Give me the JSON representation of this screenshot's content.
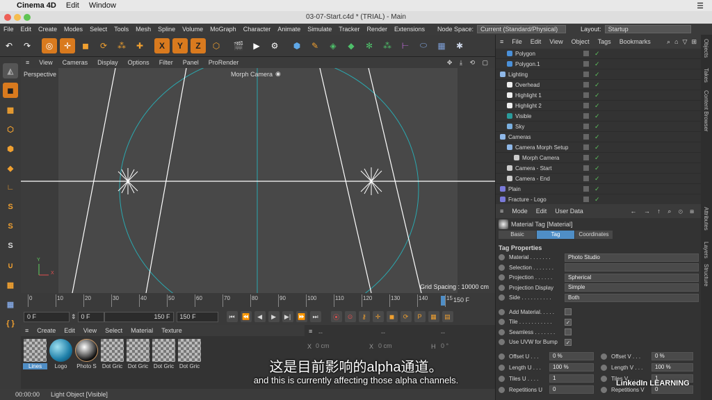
{
  "mac_menu": {
    "app": "Cinema 4D",
    "items": [
      "Edit",
      "Window"
    ]
  },
  "window_title": "03-07-Start.c4d * (TRIAL) - Main",
  "main_menu": [
    "File",
    "Edit",
    "Create",
    "Modes",
    "Select",
    "Tools",
    "Mesh",
    "Spline",
    "Volume",
    "MoGraph",
    "Character",
    "Animate",
    "Simulate",
    "Tracker",
    "Render",
    "Extensions"
  ],
  "node_space": {
    "label": "Node Space:",
    "value": "Current (Standard/Physical)"
  },
  "layout": {
    "label": "Layout:",
    "value": "Startup"
  },
  "viewport": {
    "menu": [
      "View",
      "Cameras",
      "Display",
      "Options",
      "Filter",
      "Panel",
      "ProRender"
    ],
    "name": "Perspective",
    "camera": "Morph Camera",
    "grid_spacing": "Grid Spacing : 10000 cm",
    "axis_y": "Y",
    "axis_x": "X"
  },
  "timeline": {
    "ticks": [
      "0",
      "10",
      "20",
      "30",
      "40",
      "50",
      "60",
      "70",
      "80",
      "90",
      "100",
      "110",
      "120",
      "130",
      "140",
      "15"
    ],
    "end_label": "150 F"
  },
  "transport": {
    "current": "0 F",
    "start": "0 F",
    "end": "150 F",
    "max": "150 F"
  },
  "material_manager": {
    "menu": [
      "Create",
      "Edit",
      "View",
      "Select",
      "Material",
      "Texture"
    ],
    "materials": [
      "Lines",
      "Logo",
      "Photo S",
      "Dot Gric",
      "Dot Gric",
      "Dot Gric",
      "Dot Gric"
    ]
  },
  "coords": {
    "dash": "--",
    "x_label": "X",
    "x_value": "0 cm",
    "x2_label": "X",
    "x2_value": "0 cm",
    "h_label": "H",
    "h_value": "0 °"
  },
  "status": {
    "time": "00:00:00",
    "text": "Light Object [Visible]"
  },
  "object_manager": {
    "menu": [
      "File",
      "Edit",
      "View",
      "Object",
      "Tags",
      "Bookmarks"
    ],
    "objects": [
      {
        "name": "Polygon",
        "indent": 1,
        "icon": "#4a90d9"
      },
      {
        "name": "Polygon.1",
        "indent": 1,
        "icon": "#4a90d9"
      },
      {
        "name": "Lighting",
        "indent": 0,
        "icon": "#8fb8e8"
      },
      {
        "name": "Overhead",
        "indent": 1,
        "icon": "#eeeeee"
      },
      {
        "name": "Highlight 1",
        "indent": 1,
        "icon": "#eeeeee"
      },
      {
        "name": "Highlight 2",
        "indent": 1,
        "icon": "#eeeeee"
      },
      {
        "name": "Visible",
        "indent": 1,
        "icon": "#2a9c9c"
      },
      {
        "name": "Sky",
        "indent": 1,
        "icon": "#7ab0e0"
      },
      {
        "name": "Cameras",
        "indent": 0,
        "icon": "#8fb8e8"
      },
      {
        "name": "Camera Morph Setup",
        "indent": 1,
        "icon": "#8fb8e8"
      },
      {
        "name": "Morph Camera",
        "indent": 2,
        "icon": "#cccccc"
      },
      {
        "name": "Camera - Start",
        "indent": 1,
        "icon": "#cccccc"
      },
      {
        "name": "Camera - End",
        "indent": 1,
        "icon": "#cccccc"
      },
      {
        "name": "Plain",
        "indent": 0,
        "icon": "#7a7ad9"
      },
      {
        "name": "Fracture - Logo",
        "indent": 0,
        "icon": "#7a7ad9"
      }
    ]
  },
  "attributes": {
    "menu": [
      "Mode",
      "Edit",
      "User Data"
    ],
    "title": "Material Tag [Material]",
    "tabs": [
      "Basic",
      "Tag",
      "Coordinates"
    ],
    "section": "Tag Properties",
    "props": [
      {
        "label": "Material . . . . . . .",
        "value": "Photo Studio"
      },
      {
        "label": "Selection . . . . . . .",
        "value": ""
      },
      {
        "label": "Projection . . . . . .",
        "value": "Spherical"
      },
      {
        "label": "Projection Display",
        "value": "Simple"
      },
      {
        "label": "Side . . . . . . . . . .",
        "value": "Both"
      }
    ],
    "checks": [
      {
        "label": "Add Material. . . . .",
        "checked": false
      },
      {
        "label": "Tile . . . . . . . . . . .",
        "checked": true
      },
      {
        "label": "Seamless . . . . . . .",
        "checked": false
      },
      {
        "label": "Use UVW for Bump",
        "checked": true
      }
    ],
    "numbers": [
      {
        "l1": "Offset U . . .",
        "v1": "0 %",
        "l2": "Offset V . . .",
        "v2": "0 %"
      },
      {
        "l1": "Length U . . .",
        "v1": "100 %",
        "l2": "Length V . . .",
        "v2": "100 %"
      },
      {
        "l1": "Tiles U . . . .",
        "v1": "1",
        "l2": "Tiles V. . . .",
        "v2": "1"
      },
      {
        "l1": "Repetitions U",
        "v1": "0",
        "l2": "Repetitions V",
        "v2": "0"
      }
    ]
  },
  "side_tabs": [
    "Objects",
    "Takes",
    "Content Browser",
    "Attributes",
    "Layers",
    "Structure"
  ],
  "subtitle_cn": "这是目前影响的alpha通道。",
  "subtitle_en": "and this is currently affecting those alpha channels.",
  "watermark": "LinkedIn LEARNING"
}
